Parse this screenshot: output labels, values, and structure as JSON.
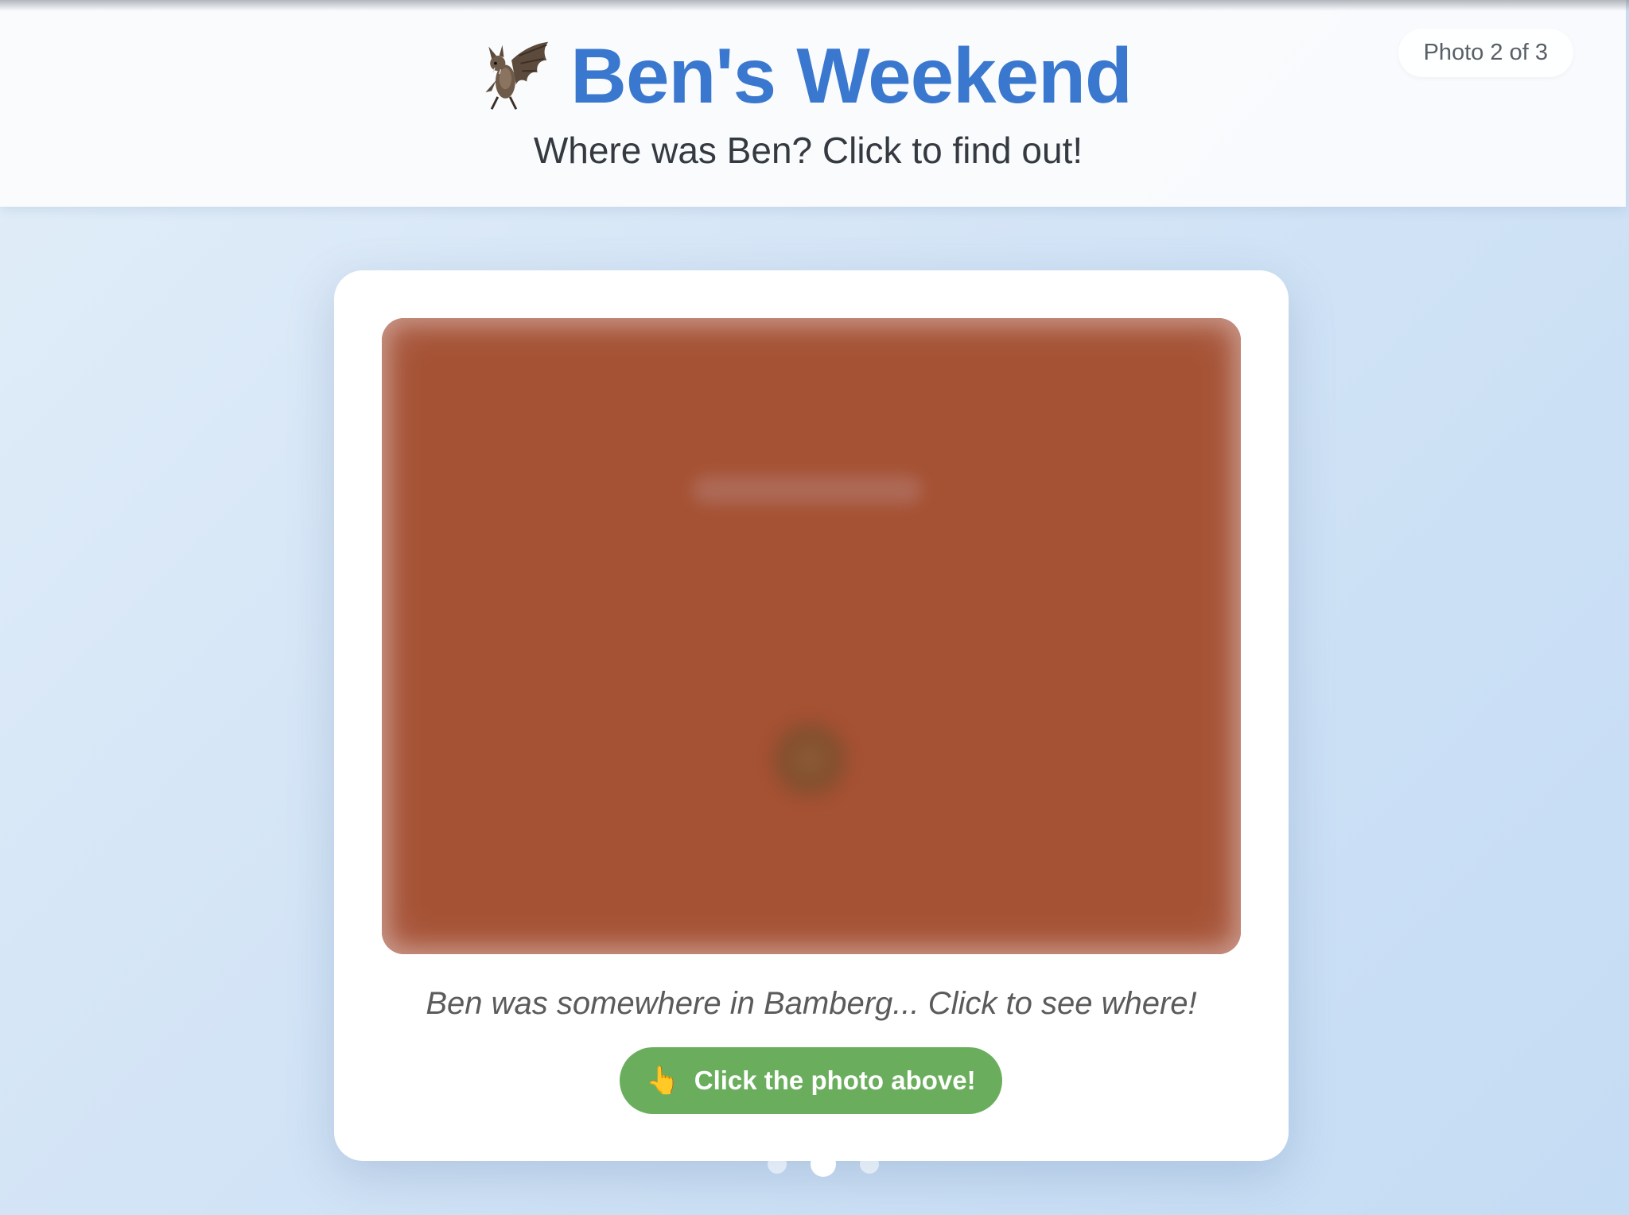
{
  "header": {
    "title": "Ben's Weekend",
    "subtitle": "Where was Ben? Click to find out!",
    "icon": "bat-icon",
    "counter": "Photo 2 of 3"
  },
  "photo": {
    "state": "blurred",
    "color": "#a55133"
  },
  "caption": "Ben was somewhere in Bamberg... Click to see where!",
  "cta": {
    "icon": "pointing-finger-icon",
    "label": "Click the photo above!",
    "color": "#6aae5d"
  },
  "pagination": {
    "total": 3,
    "current": 2
  },
  "colors": {
    "title": "#3a78cf",
    "background": "#d3e4f6"
  }
}
